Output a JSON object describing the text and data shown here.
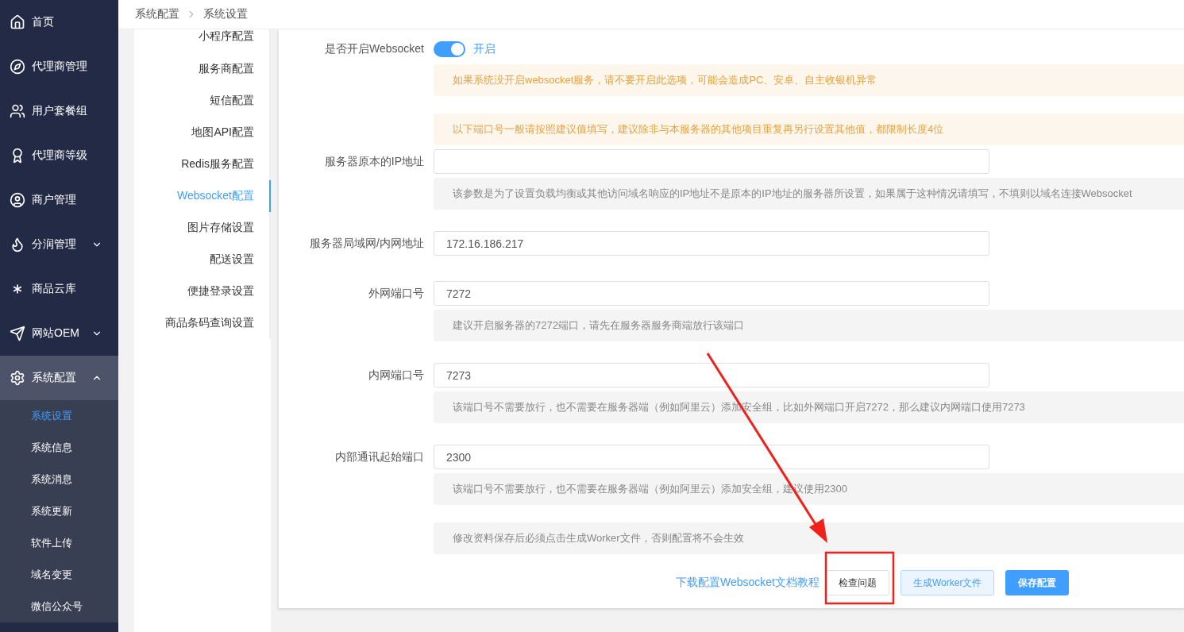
{
  "sidebar": {
    "items": [
      {
        "label": "首页",
        "selected": false
      },
      {
        "label": "代理商管理",
        "selected": false
      },
      {
        "label": "用户套餐组",
        "selected": false
      },
      {
        "label": "代理商等级",
        "selected": false
      },
      {
        "label": "商户管理",
        "selected": false
      },
      {
        "label": "分润管理",
        "selected": false,
        "expanded": false
      },
      {
        "label": "商品云库",
        "selected": false
      },
      {
        "label": "网站OEM",
        "selected": false,
        "expanded": false
      },
      {
        "label": "系统配置",
        "selected": true,
        "expanded": true,
        "children": [
          {
            "label": "系统设置",
            "selected": true
          },
          {
            "label": "系统信息",
            "selected": false
          },
          {
            "label": "系统消息",
            "selected": false
          },
          {
            "label": "系统更新",
            "selected": false
          },
          {
            "label": "软件上传",
            "selected": false
          },
          {
            "label": "域名变更",
            "selected": false
          },
          {
            "label": "微信公众号",
            "selected": false
          }
        ]
      }
    ]
  },
  "breadcrumb": [
    "系统配置",
    "系统设置"
  ],
  "settings_menu": [
    {
      "label": "小程序配置",
      "selected": false
    },
    {
      "label": "服务商配置",
      "selected": false
    },
    {
      "label": "短信配置",
      "selected": false
    },
    {
      "label": "地图API配置",
      "selected": false
    },
    {
      "label": "Redis服务配置",
      "selected": false
    },
    {
      "label": "Websocket配置",
      "selected": true
    },
    {
      "label": "图片存储设置",
      "selected": false
    },
    {
      "label": "配送设置",
      "selected": false
    },
    {
      "label": "便捷登录设置",
      "selected": false
    },
    {
      "label": "商品条码查询设置",
      "selected": false
    }
  ],
  "form": {
    "rows": [
      {
        "kind": "toggle",
        "label": "是否开启Websocket",
        "on": true,
        "status_text": "开启"
      },
      {
        "kind": "warning",
        "text": "如果系统没开启websocket服务，请不要开启此选项，可能会造成PC、安卓、自主收银机异常"
      },
      {
        "kind": "warning",
        "text": "以下端口号一般请按照建议值填写，建议除非与本服务器的其他项目重复再另行设置其他值，都限制长度4位"
      },
      {
        "kind": "field",
        "label": "服务器原本的IP地址"
      },
      {
        "kind": "note",
        "text": "该参数是为了设置负载均衡或其他访问域名响应的IP地址不是原本的IP地址的服务器所设置，如果属于这种情况请填写，不填则以域名连接Websocket"
      },
      {
        "kind": "field",
        "label": "服务器局域网/内网地址",
        "value": "172.16.186.217"
      },
      {
        "kind": "field",
        "label": "外网端口号",
        "value": "7272"
      },
      {
        "kind": "note",
        "text": "建议开启服务器的7272端口，请先在服务器服务商端放行该端口"
      },
      {
        "kind": "field",
        "label": "内网端口号",
        "value": "7273"
      },
      {
        "kind": "note",
        "text": "该端口号不需要放行，也不需要在服务器端（例如阿里云）添加安全组，比如外网端口开启7272，那么建议内网端口使用7273"
      },
      {
        "kind": "field",
        "label": "内部通讯起始端口",
        "value": "2300"
      },
      {
        "kind": "note",
        "text": "该端口号不需要放行，也不需要在服务器端（例如阿里云）添加安全组，建议使用2300"
      },
      {
        "kind": "note",
        "text": "修改资料保存后必须点击生成Worker文件，否则配置将不会生效"
      }
    ],
    "link": "下载配置Websocket文档教程",
    "buttons": [
      {
        "kind": "default",
        "label": "检查问题"
      },
      {
        "kind": "plain",
        "label": "生成Worker文件"
      },
      {
        "kind": "primary",
        "label": "保存配置"
      }
    ]
  }
}
